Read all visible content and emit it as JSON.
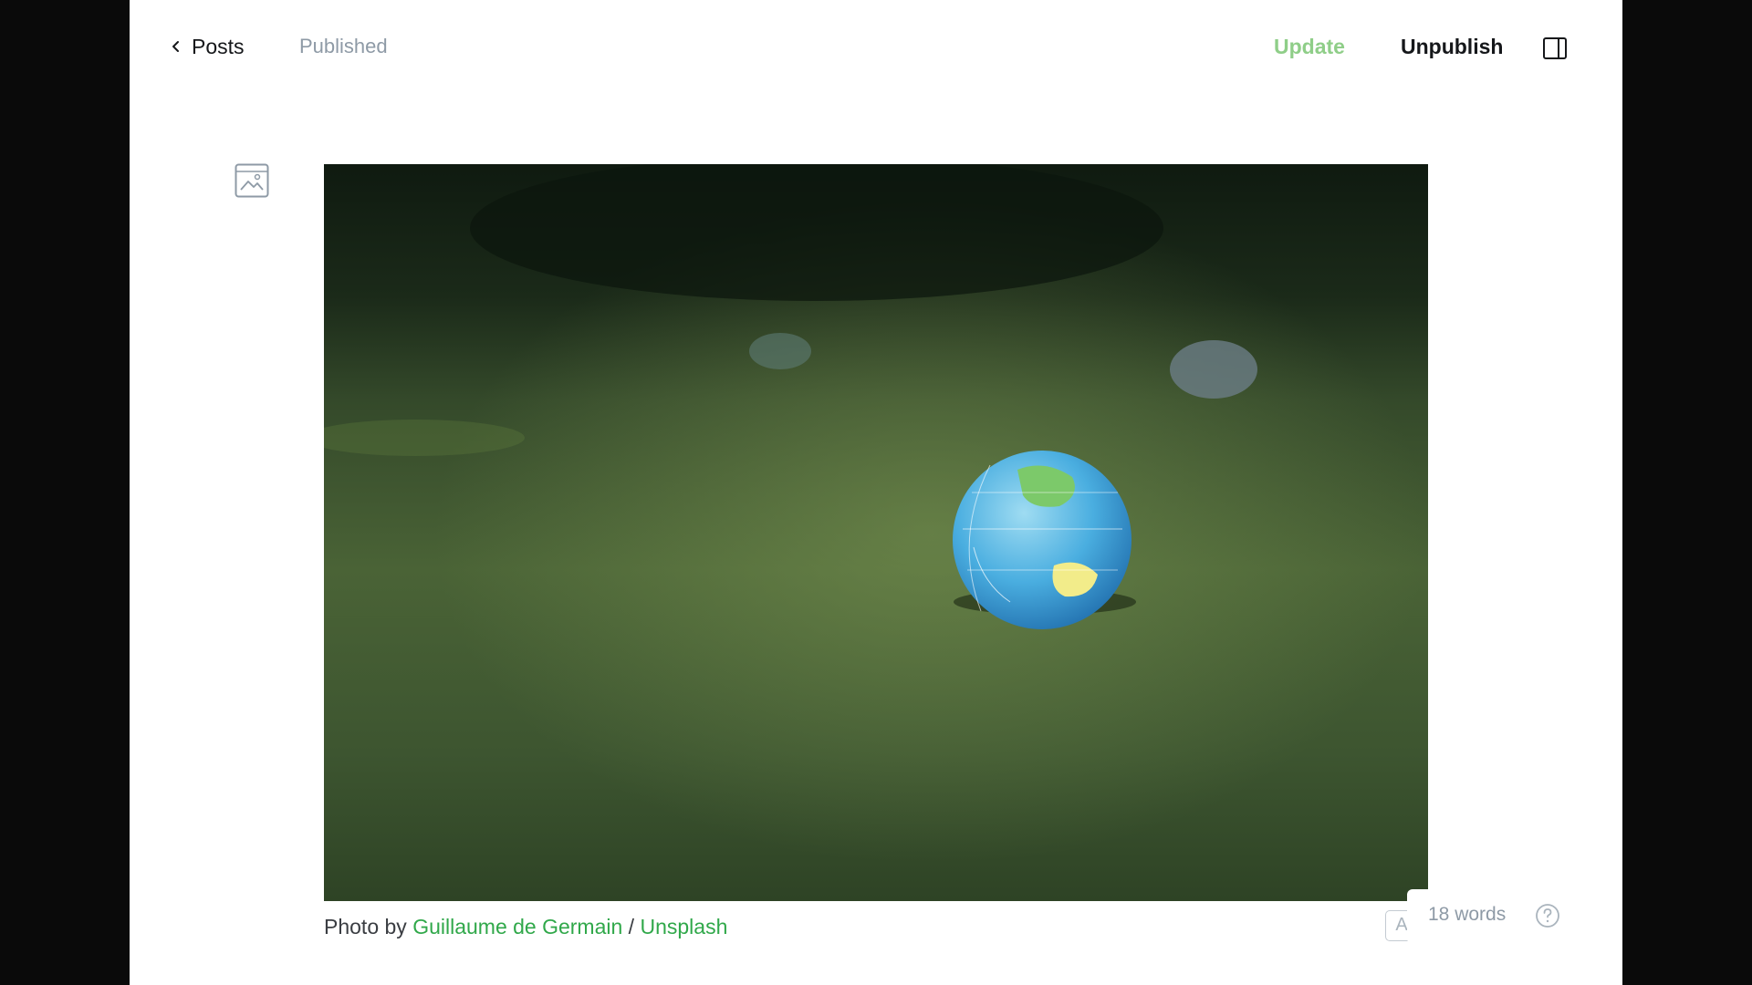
{
  "header": {
    "back_label": "Posts",
    "status": "Published",
    "update_label": "Update",
    "unpublish_label": "Unpublish"
  },
  "feature_image": {
    "caption_prefix": "Photo by ",
    "author": "Guillaume de Germain",
    "separator": " / ",
    "source": "Unsplash"
  },
  "footer": {
    "toolbar_glyph": "A",
    "word_count": "18 words"
  },
  "colors": {
    "accent": "#30a84a",
    "update_disabled": "#8fce88",
    "muted": "#8e9aa6"
  },
  "icons": [
    "chevron-left-icon",
    "image-icon",
    "sidebar-toggle-icon",
    "help-icon"
  ]
}
